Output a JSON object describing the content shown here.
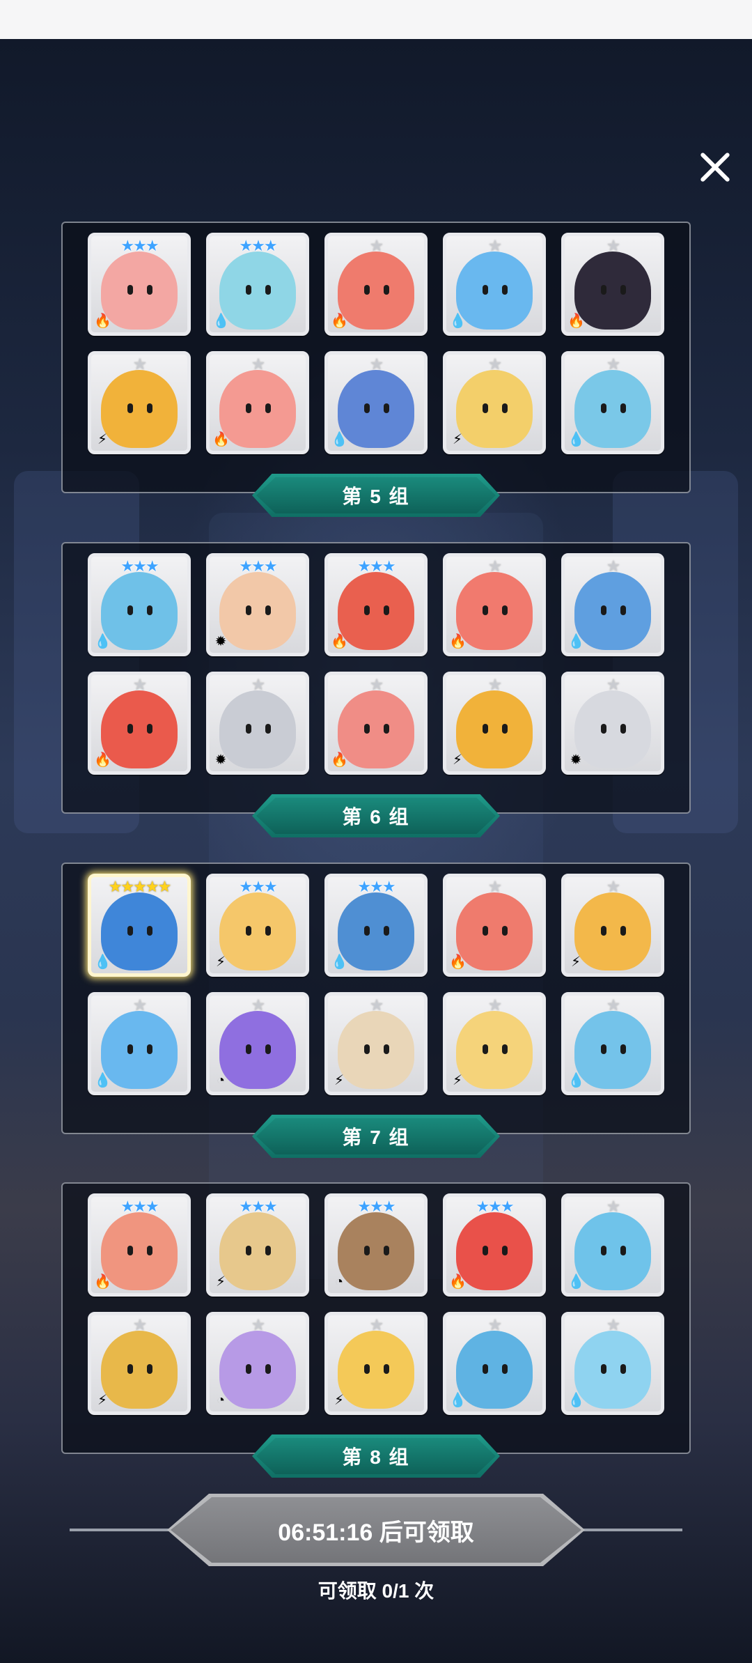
{
  "groups": [
    {
      "label": "第 5 组",
      "cards": [
        {
          "stars": 3,
          "tier": "blue",
          "element": "fire",
          "color": "#f3a7a3"
        },
        {
          "stars": 3,
          "tier": "blue",
          "element": "water",
          "color": "#8fd6e6"
        },
        {
          "stars": 1,
          "tier": "gray",
          "element": "fire",
          "color": "#ef7b6d"
        },
        {
          "stars": 1,
          "tier": "gray",
          "element": "water",
          "color": "#69b8ef"
        },
        {
          "stars": 1,
          "tier": "gray",
          "element": "fire",
          "color": "#2f2a3a"
        },
        {
          "stars": 1,
          "tier": "gray",
          "element": "thunder",
          "color": "#f1b23a"
        },
        {
          "stars": 1,
          "tier": "gray",
          "element": "fire",
          "color": "#f49a92"
        },
        {
          "stars": 1,
          "tier": "gray",
          "element": "water",
          "color": "#5f86d6"
        },
        {
          "stars": 1,
          "tier": "gray",
          "element": "thunder",
          "color": "#f3cf6a"
        },
        {
          "stars": 1,
          "tier": "gray",
          "element": "water",
          "color": "#7ac8e8"
        }
      ]
    },
    {
      "label": "第 6 组",
      "cards": [
        {
          "stars": 3,
          "tier": "blue",
          "element": "water",
          "color": "#6fc1e8"
        },
        {
          "stars": 3,
          "tier": "blue",
          "element": "light",
          "color": "#f2c8a8"
        },
        {
          "stars": 3,
          "tier": "blue",
          "element": "fire",
          "color": "#e9604f"
        },
        {
          "stars": 1,
          "tier": "gray",
          "element": "fire",
          "color": "#f17a6e"
        },
        {
          "stars": 1,
          "tier": "gray",
          "element": "water",
          "color": "#5f9fe0"
        },
        {
          "stars": 1,
          "tier": "gray",
          "element": "fire",
          "color": "#ea5a4c"
        },
        {
          "stars": 1,
          "tier": "gray",
          "element": "light",
          "color": "#c9ccd4"
        },
        {
          "stars": 1,
          "tier": "gray",
          "element": "fire",
          "color": "#f08d86"
        },
        {
          "stars": 1,
          "tier": "gray",
          "element": "thunder",
          "color": "#f1b23a"
        },
        {
          "stars": 1,
          "tier": "gray",
          "element": "light",
          "color": "#d7d9df"
        }
      ]
    },
    {
      "label": "第 7 组",
      "cards": [
        {
          "stars": 5,
          "tier": "gold",
          "element": "water",
          "color": "#3f86d9"
        },
        {
          "stars": 3,
          "tier": "blue",
          "element": "thunder",
          "color": "#f5c76a"
        },
        {
          "stars": 3,
          "tier": "blue",
          "element": "water",
          "color": "#4f8fd3"
        },
        {
          "stars": 1,
          "tier": "gray",
          "element": "fire",
          "color": "#ef7b6d"
        },
        {
          "stars": 1,
          "tier": "gray",
          "element": "thunder",
          "color": "#f3b84a"
        },
        {
          "stars": 1,
          "tier": "gray",
          "element": "water",
          "color": "#69b8ef"
        },
        {
          "stars": 1,
          "tier": "gray",
          "element": "dark",
          "color": "#8f6fe0"
        },
        {
          "stars": 1,
          "tier": "gray",
          "element": "thunder",
          "color": "#e9d6b8"
        },
        {
          "stars": 1,
          "tier": "gray",
          "element": "thunder",
          "color": "#f5d37a"
        },
        {
          "stars": 1,
          "tier": "gray",
          "element": "water",
          "color": "#74c3ea"
        }
      ]
    },
    {
      "label": "第 8 组",
      "cards": [
        {
          "stars": 3,
          "tier": "blue",
          "element": "fire",
          "color": "#f0957f"
        },
        {
          "stars": 3,
          "tier": "blue",
          "element": "thunder",
          "color": "#e7c88c"
        },
        {
          "stars": 3,
          "tier": "blue",
          "element": "dark",
          "color": "#a9825e"
        },
        {
          "stars": 3,
          "tier": "blue",
          "element": "fire",
          "color": "#e9514a"
        },
        {
          "stars": 1,
          "tier": "gray",
          "element": "water",
          "color": "#6fc3ea"
        },
        {
          "stars": 1,
          "tier": "gray",
          "element": "thunder",
          "color": "#e8b84a"
        },
        {
          "stars": 1,
          "tier": "gray",
          "element": "dark",
          "color": "#b79ae6"
        },
        {
          "stars": 1,
          "tier": "gray",
          "element": "thunder",
          "color": "#f4c958"
        },
        {
          "stars": 1,
          "tier": "gray",
          "element": "water",
          "color": "#5fb3e3"
        },
        {
          "stars": 1,
          "tier": "gray",
          "element": "water",
          "color": "#8fd3f0"
        }
      ]
    }
  ],
  "element_icons": {
    "fire": "🔥",
    "water": "💧",
    "thunder": "⚡",
    "light": "✹",
    "dark": "◔"
  },
  "claim": {
    "button_label": "06:51:16 后可领取",
    "count_label": "可领取 0/1 次"
  }
}
